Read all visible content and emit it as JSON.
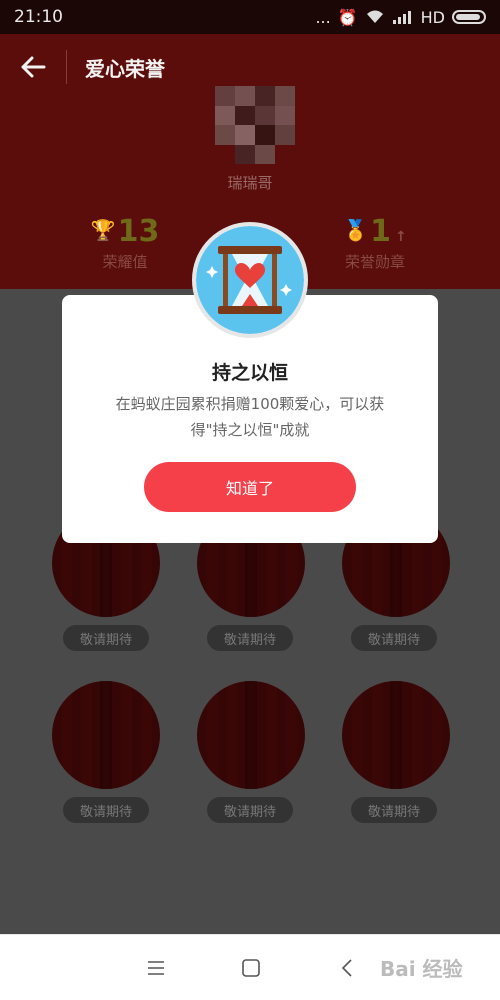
{
  "status": {
    "time": "21:10",
    "dots": "...",
    "network": "HD"
  },
  "header": {
    "title": "爱心荣誉",
    "username": "瑞瑞哥"
  },
  "stats": [
    {
      "value": "13",
      "label": "荣耀值"
    },
    {
      "value": "1",
      "label": "荣誉勋章",
      "trend": "↑"
    }
  ],
  "grid": {
    "pending_label": "敬请期待"
  },
  "modal": {
    "title": "持之以恒",
    "description": "在蚂蚁庄园累积捐赠100颗爱心，可以获得\"持之以恒\"成就",
    "button": "知道了"
  },
  "navbar": {
    "watermark": "Bai 经验"
  },
  "colors": {
    "accent": "#f5404a",
    "header_dim": "#5a0d0a",
    "overlay": "#4a4a4a"
  },
  "icons": [
    "back-arrow-icon",
    "trophy-icon",
    "medal-icon",
    "hourglass-heart-icon",
    "menu-icon",
    "home-icon",
    "back-nav-icon"
  ]
}
